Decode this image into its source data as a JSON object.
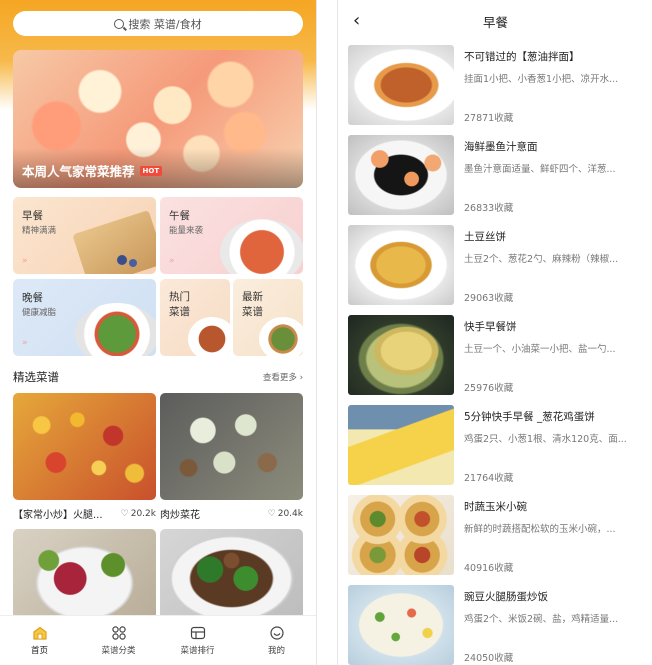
{
  "left": {
    "search_placeholder": "搜索 菜谱/食材",
    "banner": {
      "title": "本周人气家常菜推荐",
      "badge": "HOT"
    },
    "categories": [
      {
        "title": "早餐",
        "subtitle": "精神满满"
      },
      {
        "title": "午餐",
        "subtitle": "能量来袭"
      },
      {
        "title": "晚餐",
        "subtitle": "健康减脂"
      },
      {
        "title": "热门\n菜谱",
        "subtitle": ""
      },
      {
        "title": "最新\n菜谱",
        "subtitle": ""
      }
    ],
    "arrows": "»",
    "section": {
      "title": "精选菜谱",
      "more": "查看更多 ›"
    },
    "recipes": [
      {
        "name": "【家常小炒】火腿...",
        "likes": "20.2k"
      },
      {
        "name": "肉炒菜花",
        "likes": "20.4k"
      },
      {
        "name": "",
        "likes": ""
      },
      {
        "name": "",
        "likes": ""
      }
    ],
    "tabs": [
      {
        "label": "首页",
        "icon": "home-icon"
      },
      {
        "label": "菜谱分类",
        "icon": "grid-icon"
      },
      {
        "label": "菜谱排行",
        "icon": "ranking-icon"
      },
      {
        "label": "我的",
        "icon": "profile-icon"
      }
    ],
    "colors": {
      "accent": "#f5a623",
      "hot": "#f04b3a"
    }
  },
  "right": {
    "title": "早餐",
    "back": "‹",
    "items": [
      {
        "name": "不可错过的【葱油拌面】",
        "desc": "挂面1小把、小香葱1小把、凉开水...",
        "favs": "27871收藏"
      },
      {
        "name": "海鲜墨鱼汁意面",
        "desc": "墨鱼汁意面适量、鲜虾四个、洋葱...",
        "favs": "26833收藏"
      },
      {
        "name": "土豆丝饼",
        "desc": "土豆2个、葱花2勺、麻辣粉（辣椒...",
        "favs": "29063收藏"
      },
      {
        "name": "快手早餐饼",
        "desc": "土豆一个、小油菜一小把、盐一勺...",
        "favs": "25976收藏"
      },
      {
        "name": "5分钟快手早餐 _葱花鸡蛋饼",
        "desc": "鸡蛋2只、小葱1根、清水120克、面...",
        "favs": "21764收藏"
      },
      {
        "name": "时蔬玉米小碗",
        "desc": "新鲜的时蔬搭配松软的玉米小碗，...",
        "favs": "40916收藏"
      },
      {
        "name": "豌豆火腿肠蛋炒饭",
        "desc": "鸡蛋2个、米饭2碗、盐，鸡精适量...",
        "favs": "24050收藏"
      }
    ]
  }
}
